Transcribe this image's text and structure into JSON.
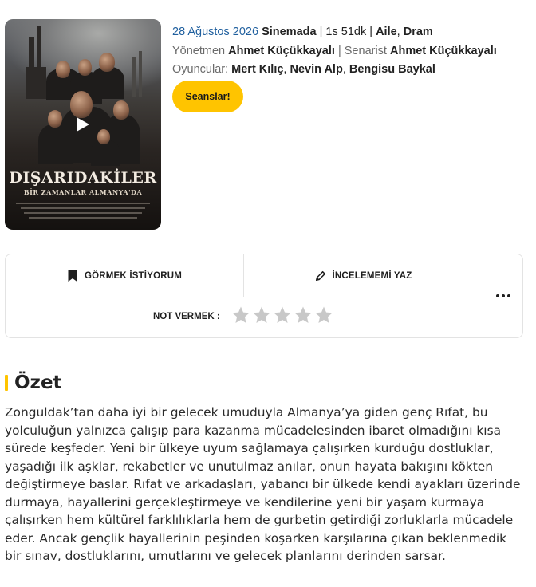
{
  "movie": {
    "poster": {
      "title": "DIŞARIDAKİLER",
      "subtitle": "BİR ZAMANLAR ALMANYA'DA"
    },
    "date": "28 Ağustos 2026",
    "status": "Sinemada",
    "duration": "1s 51dk",
    "genres": [
      "Aile",
      "Dram"
    ],
    "director_label": "Yönetmen",
    "director": "Ahmet Küçükkayalı",
    "writer_label": "Senarist",
    "writer": "Ahmet Küçükkayalı",
    "cast_label": "Oyuncular:",
    "cast": [
      "Mert Kılıç",
      "Nevin Alp",
      "Bengisu Baykal"
    ],
    "sessions_button": "Seanslar!"
  },
  "actions": {
    "watchlist": "GÖRMEK İSTİYORUM",
    "review": "İNCELEMEMİ YAZ",
    "rate_label": "NOT VERMEK :",
    "rating_max": 5,
    "rating_value": 0,
    "star_color": "#c8c8c8",
    "more_icon": "more-dots-icon"
  },
  "summary": {
    "title": "Özet",
    "accent_color": "#ffc400",
    "text": "Zonguldak’tan daha iyi bir gelecek umuduyla Almanya’ya giden genç Rıfat, bu yolculuğun yalnızca çalışıp para kazanma mücadelesinden ibaret olmadığını kısa sürede keşfeder. Yeni bir ülkeye uyum sağlamaya çalışırken kurduğu dostluklar, yaşadığı ilk aşklar, rekabetler ve unutulmaz anılar, onun hayata bakışını kökten değiştirmeye başlar. Rıfat ve arkadaşları, yabancı bir ülkede kendi ayakları üzerinde durmaya, hayallerini gerçekleştirmeye ve kendilerine yeni bir yaşam kurmaya çalışırken hem kültürel farklılıklarla hem de gurbetin getirdiği zorluklarla mücadele eder. Ancak gençlik hayallerinin peşinden koşarken karşılarına çıkan beklenmedik bir sınav, dostluklarını, umutlarını ve gelecek planlarını derinden sarsar."
  }
}
